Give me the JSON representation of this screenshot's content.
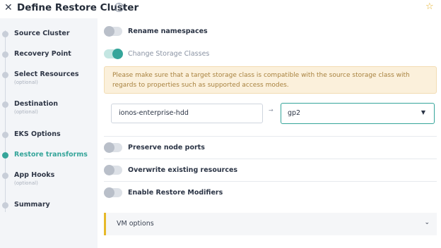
{
  "header": {
    "title": "Define Restore Cluster",
    "close_icon": "close-icon",
    "help_icon": "?",
    "star_icon": "☆"
  },
  "sidebar": {
    "steps": [
      {
        "label": "Source Cluster",
        "sub": "",
        "active": false
      },
      {
        "label": "Recovery Point",
        "sub": "",
        "active": false
      },
      {
        "label": "Select Resources",
        "sub": "(optional)",
        "active": false
      },
      {
        "label": "Destination",
        "sub": "(optional)",
        "active": false
      },
      {
        "label": "EKS Options",
        "sub": "",
        "active": false
      },
      {
        "label": "Restore transforms",
        "sub": "",
        "active": true
      },
      {
        "label": "App Hooks",
        "sub": "(optional)",
        "active": false
      },
      {
        "label": "Summary",
        "sub": "",
        "active": false
      }
    ]
  },
  "main": {
    "rename_namespaces": {
      "label": "Rename namespaces",
      "enabled": false
    },
    "change_storage_classes": {
      "label": "Change Storage Classes",
      "enabled": true
    },
    "warning": "Please make sure that a target storage class is compatible with the source storage class with regards to properties such as supported access modes.",
    "storage_mapping": {
      "source": "ionos-enterprise-hdd",
      "arrow": "→",
      "target": "gp2",
      "caret": "▼"
    },
    "preserve_node_ports": {
      "label": "Preserve node ports",
      "enabled": false
    },
    "overwrite_existing": {
      "label": "Overwrite existing resources",
      "enabled": false
    },
    "enable_restore_modifiers": {
      "label": "Enable Restore Modifiers",
      "enabled": false
    },
    "vm_options": {
      "label": "VM options",
      "chevron": "⌄"
    }
  },
  "colors": {
    "accent": "#35a59a",
    "warning_bg": "#fbf0db",
    "warning_text": "#a8823f",
    "vm_border": "#e6b92a"
  }
}
